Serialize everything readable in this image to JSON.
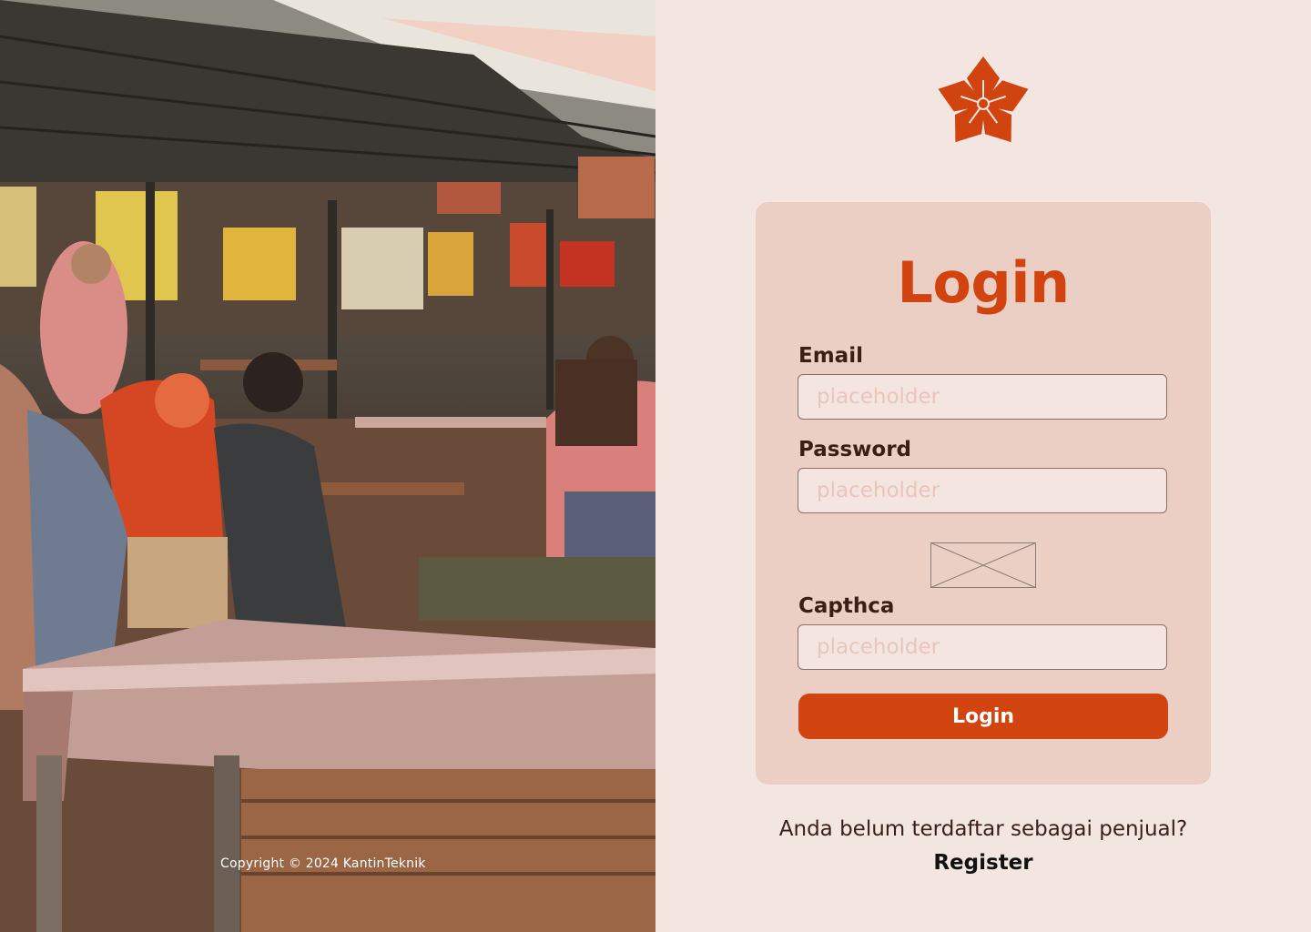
{
  "photo": {
    "copyright": "Copyright © 2024 KantinTeknik"
  },
  "logo": {
    "icon": "flower-icon",
    "color": "#d2440f"
  },
  "login_card": {
    "title": "Login",
    "email_label": "Email",
    "email_placeholder": "placeholder",
    "password_label": "Password",
    "password_placeholder": "placeholder",
    "captcha_label": "Capthca",
    "captcha_placeholder": "placeholder",
    "submit_label": "Login"
  },
  "register": {
    "prompt": "Anda belum terdaftar sebagai penjual?",
    "link": "Register"
  },
  "colors": {
    "accent": "#d2440f",
    "background": "#f3e6e1",
    "card": "#ebcfc5",
    "text": "#3a1f16"
  }
}
